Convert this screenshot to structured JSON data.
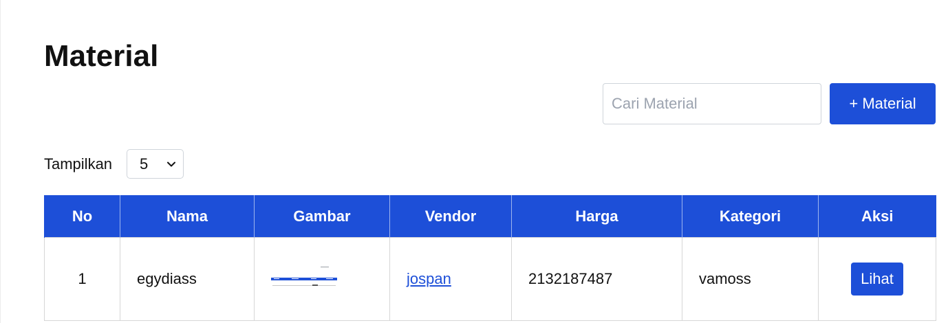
{
  "page": {
    "title": "Material"
  },
  "toolbar": {
    "search_placeholder": "Cari Material",
    "search_value": "",
    "add_label": "+ Material"
  },
  "pagination": {
    "show_label": "Tampilkan",
    "page_size": "5"
  },
  "table": {
    "columns": [
      "No",
      "Nama",
      "Gambar",
      "Vendor",
      "Harga",
      "Kategori",
      "Aksi"
    ],
    "rows": [
      {
        "no": "1",
        "nama": "egydiass",
        "vendor": "jospan",
        "harga": "2132187487",
        "kategori": "vamoss",
        "action_label": "Lihat"
      }
    ]
  },
  "colors": {
    "accent": "#1d4fd8",
    "header_text": "#ffffff",
    "border": "#d6d6d6"
  }
}
